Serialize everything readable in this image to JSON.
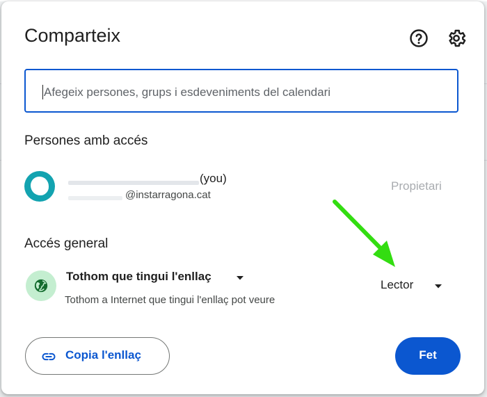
{
  "dialog": {
    "title": "Comparteix",
    "help_icon": "help-circle-icon",
    "settings_icon": "gear-icon"
  },
  "search": {
    "placeholder": "Afegeix persones, grups i esdeveniments del calendari",
    "value": ""
  },
  "people": {
    "heading": "Persones amb accés",
    "items": [
      {
        "name_suffix": "(you)",
        "email": "@instarragona.cat",
        "role": "Propietari"
      }
    ]
  },
  "general_access": {
    "heading": "Accés general",
    "scope": "Tothom que tingui l'enllaç",
    "description": "Tothom a Internet que tingui l'enllaç pot veure",
    "role": "Lector",
    "icon": "globe-icon"
  },
  "actions": {
    "copy_link": "Copia l'enllaç",
    "copy_icon": "link-icon",
    "done": "Fet"
  },
  "colors": {
    "accent": "#0b57d0",
    "annotation_arrow": "#33dd11",
    "avatar": "#13a3b0",
    "globe_bg": "#c4eed0",
    "globe_fg": "#146c2e"
  }
}
